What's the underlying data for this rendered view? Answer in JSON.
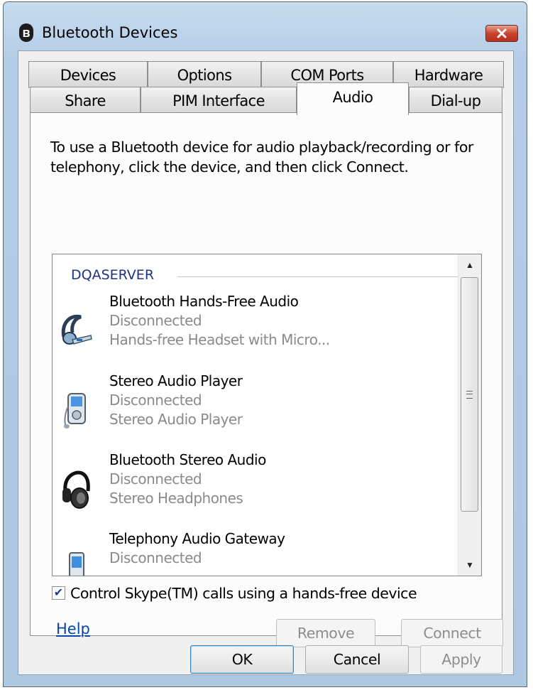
{
  "window": {
    "title": "Bluetooth Devices",
    "close_icon": "close-icon",
    "title_icon": "bluetooth-icon"
  },
  "tabs": {
    "row1": [
      "Devices",
      "Options",
      "COM Ports",
      "Hardware"
    ],
    "row2": [
      "Share",
      "PIM Interface",
      "Audio",
      "Dial-up"
    ],
    "active": "Audio"
  },
  "audio": {
    "description": "To use a Bluetooth device for audio playback/recording or for telephony, click the device, and then click Connect.",
    "group": "DQASERVER",
    "devices": [
      {
        "name": "Bluetooth Hands-Free Audio",
        "status": "Disconnected",
        "type": "Hands-free Headset with Micro...",
        "icon": "headset-icon"
      },
      {
        "name": "Stereo Audio Player",
        "status": "Disconnected",
        "type": "Stereo Audio Player",
        "icon": "audio-player-icon"
      },
      {
        "name": "Bluetooth Stereo Audio",
        "status": "Disconnected",
        "type": "Stereo Headphones",
        "icon": "headphones-icon"
      },
      {
        "name": "Telephony Audio Gateway",
        "status": "Disconnected",
        "icon": "phone-icon"
      }
    ],
    "skype_checkbox": {
      "label": "Control Skype(TM) calls using a hands-free device",
      "checked": true
    },
    "help_link": "Help",
    "remove_button": "Remove",
    "connect_button": "Connect"
  },
  "footer": {
    "ok": "OK",
    "cancel": "Cancel",
    "apply": "Apply"
  },
  "colors": {
    "link": "#0645ad",
    "group_header": "#1e3287",
    "title_bar": "#b4cde6"
  }
}
